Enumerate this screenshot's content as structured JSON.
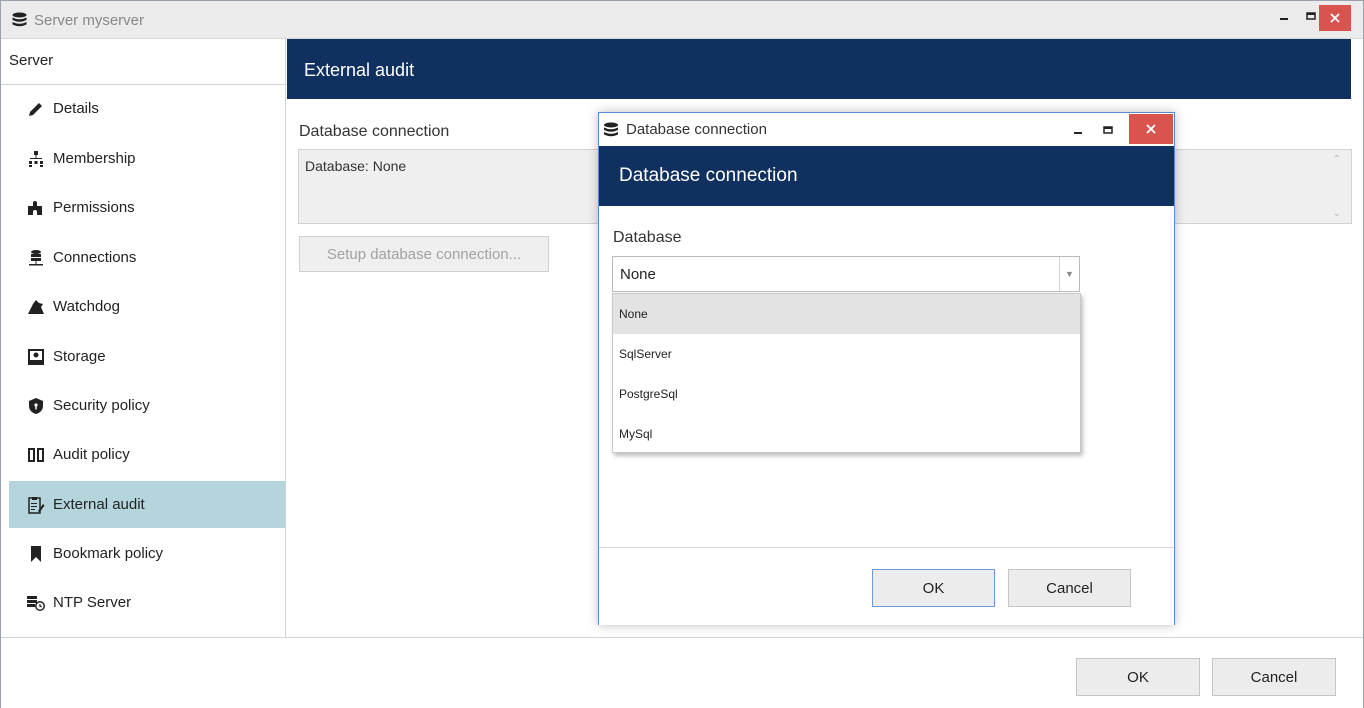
{
  "window": {
    "title": "Server myserver"
  },
  "sidebar": {
    "header": "Server",
    "items": [
      {
        "label": "Details",
        "icon": "pencil-icon"
      },
      {
        "label": "Membership",
        "icon": "hierarchy-icon"
      },
      {
        "label": "Permissions",
        "icon": "puzzle-icon"
      },
      {
        "label": "Connections",
        "icon": "server-network-icon"
      },
      {
        "label": "Watchdog",
        "icon": "dog-icon"
      },
      {
        "label": "Storage",
        "icon": "hard-drive-icon"
      },
      {
        "label": "Security policy",
        "icon": "shield-icon"
      },
      {
        "label": "Audit policy",
        "icon": "book-icon"
      },
      {
        "label": "External audit",
        "icon": "clipboard-pen-icon",
        "active": true
      },
      {
        "label": "Bookmark policy",
        "icon": "bookmark-icon"
      },
      {
        "label": "NTP Server",
        "icon": "clock-server-icon"
      }
    ]
  },
  "content": {
    "header": "External audit",
    "db_label": "Database connection",
    "db_value": "Database: None",
    "setup_button": "Setup database connection..."
  },
  "footer": {
    "ok": "OK",
    "cancel": "Cancel"
  },
  "dialog": {
    "title": "Database connection",
    "header": "Database connection",
    "field_label": "Database",
    "selected": "None",
    "options": [
      "None",
      "SqlServer",
      "PostgreSql",
      "MySql"
    ],
    "ok": "OK",
    "cancel": "Cancel"
  },
  "colors": {
    "header_bg": "#10305f",
    "active_item": "#b4d5dc",
    "close_btn": "#d9534f"
  }
}
